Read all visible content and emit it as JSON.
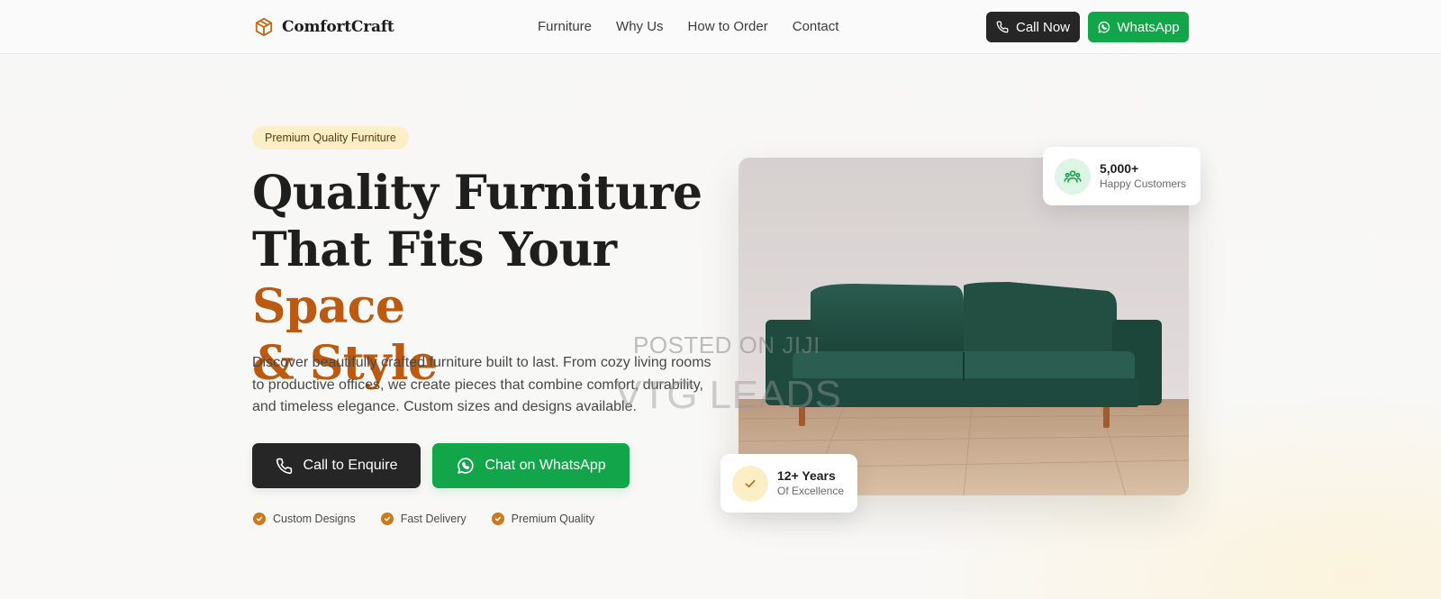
{
  "nav": {
    "brand_name": "ComfortCraft",
    "links": [
      "Furniture",
      "Why Us",
      "How to Order",
      "Contact"
    ],
    "call_now_label": "Call Now",
    "whatsapp_label": "WhatsApp"
  },
  "hero": {
    "badge": "Premium Quality Furniture",
    "headline_line1": "Quality Furniture",
    "headline_line2": "That Fits Your ",
    "headline_accent1": "Space",
    "headline_accent2": "& Style",
    "description": "Discover beautifully crafted furniture built to last. From cozy living rooms to productive offices, we create pieces that combine comfort, durability, and timeless elegance. Custom sizes and designs available.",
    "call_enquire_label": "Call to Enquire",
    "chat_whatsapp_label": "Chat on WhatsApp",
    "features": [
      "Custom Designs",
      "Fast Delivery",
      "Premium Quality"
    ]
  },
  "stats": {
    "customers_value": "5,000+",
    "customers_label": "Happy Customers",
    "years_value": "12+ Years",
    "years_label": "Of Excellence"
  },
  "watermark": {
    "line1": "POSTED ON JIJI",
    "line2": "VTG LEADS"
  },
  "colors": {
    "accent": "#bb5a10",
    "whatsapp_green": "#13a549",
    "dark_button": "#262626",
    "badge_bg": "#fcefc6",
    "sofa": "#1f4a3e"
  },
  "icons": {
    "brand": "box-icon",
    "call": "phone-icon",
    "whatsapp": "whatsapp-icon",
    "customers": "users-icon",
    "years": "check-icon"
  }
}
